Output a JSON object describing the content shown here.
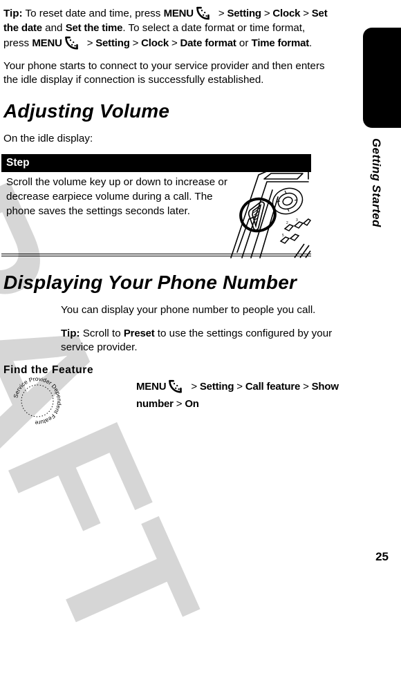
{
  "page": {
    "number": "25",
    "watermark": "DRAFT",
    "watermark_color": "#d6d6d6"
  },
  "sidebar": {
    "chapter_title": "Getting Started",
    "tab_color": "#000000"
  },
  "icons": {
    "menu_key": "menu-key-icon"
  },
  "tip_paragraph": {
    "lead": "Tip:",
    "t1": " To reset date and time, press ",
    "menu1": "MENU",
    "gt1": " > ",
    "setting1": "Setting",
    "gt2": " > ",
    "clock1": "Clock",
    "gt3": " > ",
    "set_the_date": "Set the date",
    "and": " and ",
    "set_the_time": "Set the time",
    "t2": ". To select a date format or time format, press ",
    "menu2": "MENU",
    "gt4": " > ",
    "setting2": "Setting",
    "gt5": " > ",
    "clock2": "Clock",
    "gt6": " > ",
    "date_format": "Date format",
    "or": " or ",
    "time_format": "Time format",
    "period": "."
  },
  "body_paragraph": "Your phone starts to connect to your service provider and then enters the idle display if connection is successfully established.",
  "section_volume": {
    "heading": "Adjusting Volume",
    "intro": "On the idle display:",
    "table": {
      "header": "Step",
      "cell": "Scroll the volume key up or down to increase or decrease earpiece volume during a call. The phone saves the settings seconds later.",
      "illustration": "phone-volume-key-illustration"
    }
  },
  "section_phone_number": {
    "heading": "Displaying Your Phone Number",
    "badge": {
      "name": "service-provider-dependent-feature-badge",
      "text": "Service Provider Dependent Feature"
    },
    "paragraph": "You can display your phone number to people you call.",
    "tip": {
      "lead": "Tip:",
      "t1": " Scroll to ",
      "preset": "Preset",
      "t2": " to use the settings configured by your service provider."
    },
    "find_the_feature": {
      "label": "Find the Feature",
      "menu": "MENU",
      "gt1": " > ",
      "setting": "Setting",
      "gt2": " > ",
      "call_feature": "Call feature",
      "gt3": " > ",
      "show_number": "Show number",
      "gt4": " > ",
      "on": "On"
    }
  }
}
